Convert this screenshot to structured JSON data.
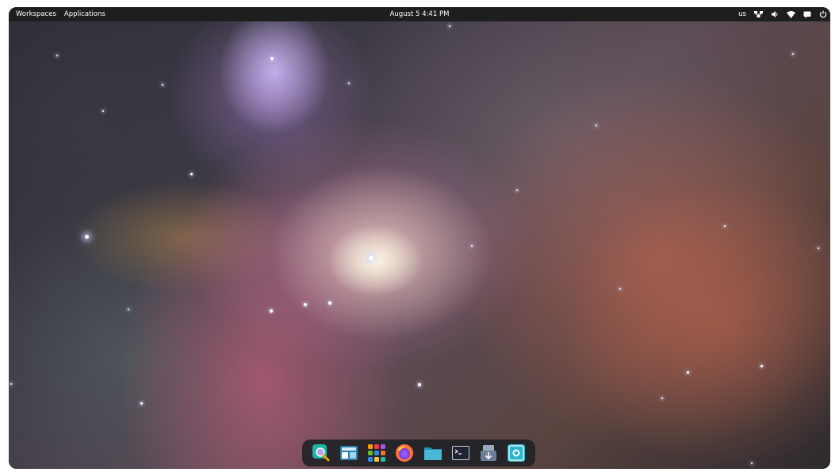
{
  "top_panel": {
    "workspaces_label": "Workspaces",
    "applications_label": "Applications",
    "clock": "August 5  4:41 PM",
    "keyboard_layout": "us",
    "indicators": [
      "network-wired-icon",
      "volume-icon",
      "wifi-icon",
      "notifications-icon",
      "power-icon"
    ]
  },
  "desktop": {
    "wallpaper": "orion-nebula"
  },
  "dock": {
    "items": [
      {
        "name": "AppCenter",
        "icon": "appcenter-search-icon",
        "accent": "#2ec4b6"
      },
      {
        "name": "Multitasking View",
        "icon": "multitasking-view-icon",
        "accent": "#3aa6c9"
      },
      {
        "name": "Applications",
        "icon": "app-grid-icon",
        "accent": "#f4a100"
      },
      {
        "name": "Firefox",
        "icon": "firefox-icon",
        "accent": "#ff7139"
      },
      {
        "name": "Files",
        "icon": "files-folder-icon",
        "accent": "#39a9c7"
      },
      {
        "name": "Terminal",
        "icon": "terminal-icon",
        "accent": "#2b2d3a"
      },
      {
        "name": "Installer",
        "icon": "installer-icon",
        "accent": "#7b8ba3"
      },
      {
        "name": "Screenshot",
        "icon": "screenshot-icon",
        "accent": "#2bb5c8"
      }
    ]
  },
  "colors": {
    "panel_bg": "#1e1e1f",
    "panel_text": "#ffffff",
    "dock_bg": "#1e2024"
  }
}
